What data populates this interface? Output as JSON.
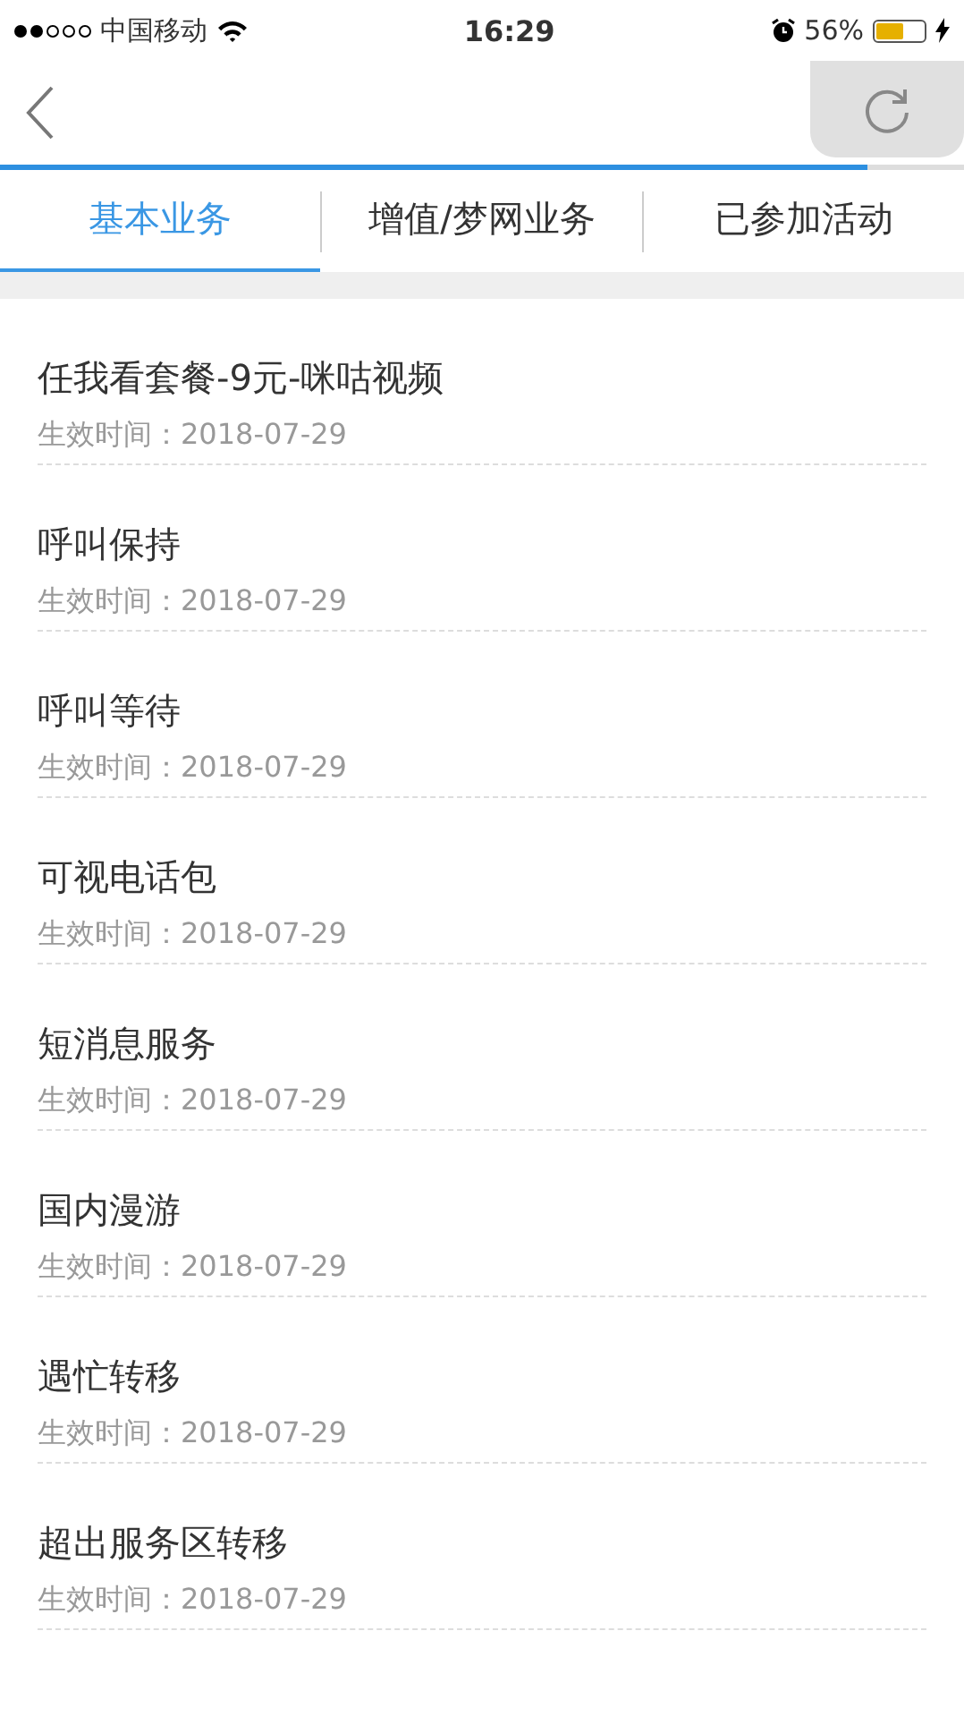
{
  "status_bar": {
    "carrier": "中国移动",
    "time": "16:29",
    "battery": "56%"
  },
  "progress": {
    "level": 0.9
  },
  "tabs": [
    {
      "label": "基本业务",
      "selected": true
    },
    {
      "label": "增值/梦网业务",
      "selected": false
    },
    {
      "label": "已参加活动",
      "selected": false
    }
  ],
  "items": [
    {
      "name": "任我看套餐-9元-咪咕视频",
      "date": "生效时间：2018-07-29"
    },
    {
      "name": "呼叫保持",
      "date": "生效时间：2018-07-29"
    },
    {
      "name": "呼叫等待",
      "date": "生效时间：2018-07-29"
    },
    {
      "name": "可视电话包",
      "date": "生效时间：2018-07-29"
    },
    {
      "name": "短消息服务",
      "date": "生效时间：2018-07-29"
    },
    {
      "name": "国内漫游",
      "date": "生效时间：2018-07-29"
    },
    {
      "name": "遇忙转移",
      "date": "生效时间：2018-07-29"
    },
    {
      "name": "超出服务区转移",
      "date": "生效时间：2018-07-29"
    }
  ]
}
